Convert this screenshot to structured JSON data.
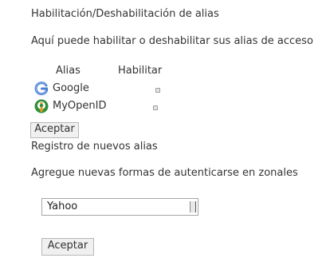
{
  "alias_section": {
    "title": "Habilitación/Deshabilitación de alias",
    "description": "Aquí puede habilitar o deshabilitar sus alias de acceso",
    "headers": {
      "alias": "Alias",
      "enable": "Habilitar"
    },
    "rows": [
      {
        "label": "Google",
        "icon": "google-icon"
      },
      {
        "label": "MyOpenID",
        "icon": "openid-icon"
      }
    ],
    "accept_label": "Aceptar"
  },
  "register_section": {
    "title": "Registro de nuevos alias",
    "description": "Agregue nuevas formas de autenticarse en zonales",
    "provider_selected": "Yahoo",
    "accept_label": "Aceptar"
  },
  "colors": {
    "text": "#333333",
    "google_blue": "#4a7fd1",
    "openid_green": "#2f8f3a",
    "openid_orange": "#f29a1e"
  }
}
